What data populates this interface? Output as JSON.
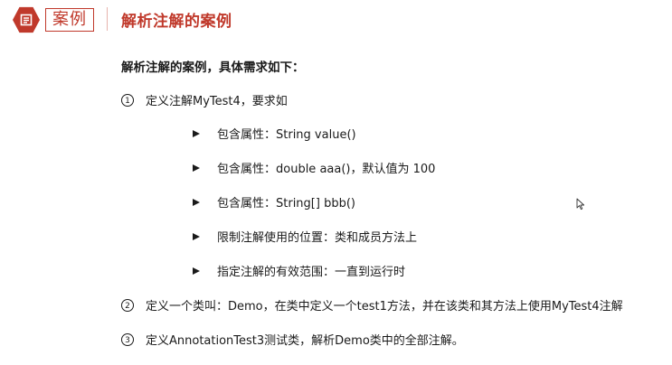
{
  "header": {
    "icon": "document-list-icon",
    "tag": "案例",
    "title": "解析注解的案例"
  },
  "subtitle": "解析注解的案例，具体需求如下：",
  "requirements": [
    {
      "number": "1",
      "text": "定义注解MyTest4，要求如"
    },
    {
      "number": "2",
      "text": "定义一个类叫：Demo，在类中定义一个test1方法，并在该类和其方法上使用MyTest4注解"
    },
    {
      "number": "3",
      "text": "定义AnnotationTest3测试类，解析Demo类中的全部注解。"
    }
  ],
  "bullets": [
    "包含属性：String value()",
    "包含属性：double aaa()，默认值为 100",
    "包含属性：String[] bbb()",
    "限制注解使用的位置：类和成员方法上",
    "指定注解的有效范围：一直到运行时"
  ],
  "colors": {
    "accent": "#c0392b",
    "text": "#1a1a1a"
  }
}
